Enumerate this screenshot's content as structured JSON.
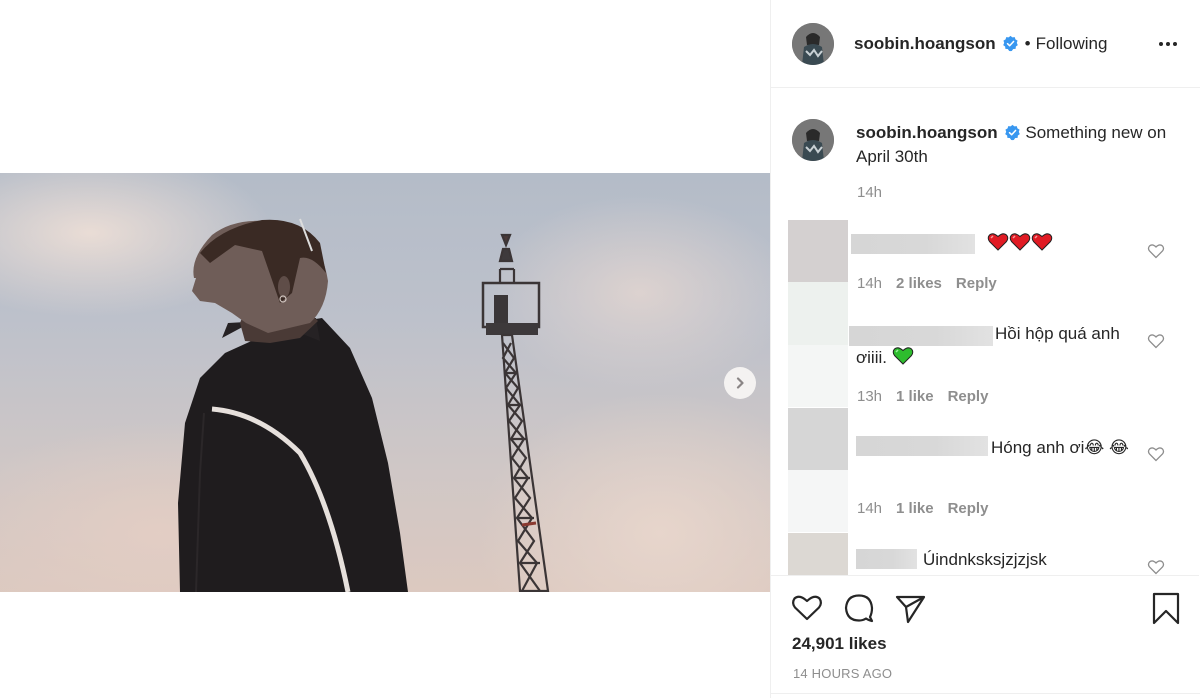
{
  "post": {
    "author": "soobin.hoangson",
    "verified": true,
    "follow_status": "Following",
    "more_icon": "more-horizontal-icon",
    "next_slide_icon": "chevron-right-icon"
  },
  "caption": {
    "author": "soobin.hoangson",
    "text": "Something new on April 30th",
    "time": "14h"
  },
  "comments": [
    {
      "author_redacted": true,
      "text": "",
      "emoji": [
        "red-heart",
        "red-heart",
        "red-heart"
      ],
      "time": "14h",
      "likes": "2 likes",
      "reply": "Reply"
    },
    {
      "author_redacted": true,
      "text": "Hồi hộp quá anh ơiiii.",
      "emoji": [
        "green-heart"
      ],
      "time": "13h",
      "likes": "1 like",
      "reply": "Reply"
    },
    {
      "author_redacted": true,
      "text": "Hóng anh ơi😂 😂",
      "emoji": [],
      "time": "14h",
      "likes": "1 like",
      "reply": "Reply"
    },
    {
      "author_redacted": true,
      "text": "Úindnksksjzjzjsk",
      "emoji": [],
      "time": "",
      "likes": "",
      "reply": ""
    }
  ],
  "actions": {
    "like_icon": "heart-outline-icon",
    "comment_icon": "comment-bubble-icon",
    "share_icon": "paper-plane-icon",
    "save_icon": "bookmark-icon"
  },
  "likes_count": "24,901 likes",
  "posted_ago": "14 HOURS AGO",
  "colors": {
    "verified_blue": "#3897f0",
    "text_primary": "#262626",
    "text_secondary": "#8e8e8e",
    "divider": "#efefef"
  }
}
